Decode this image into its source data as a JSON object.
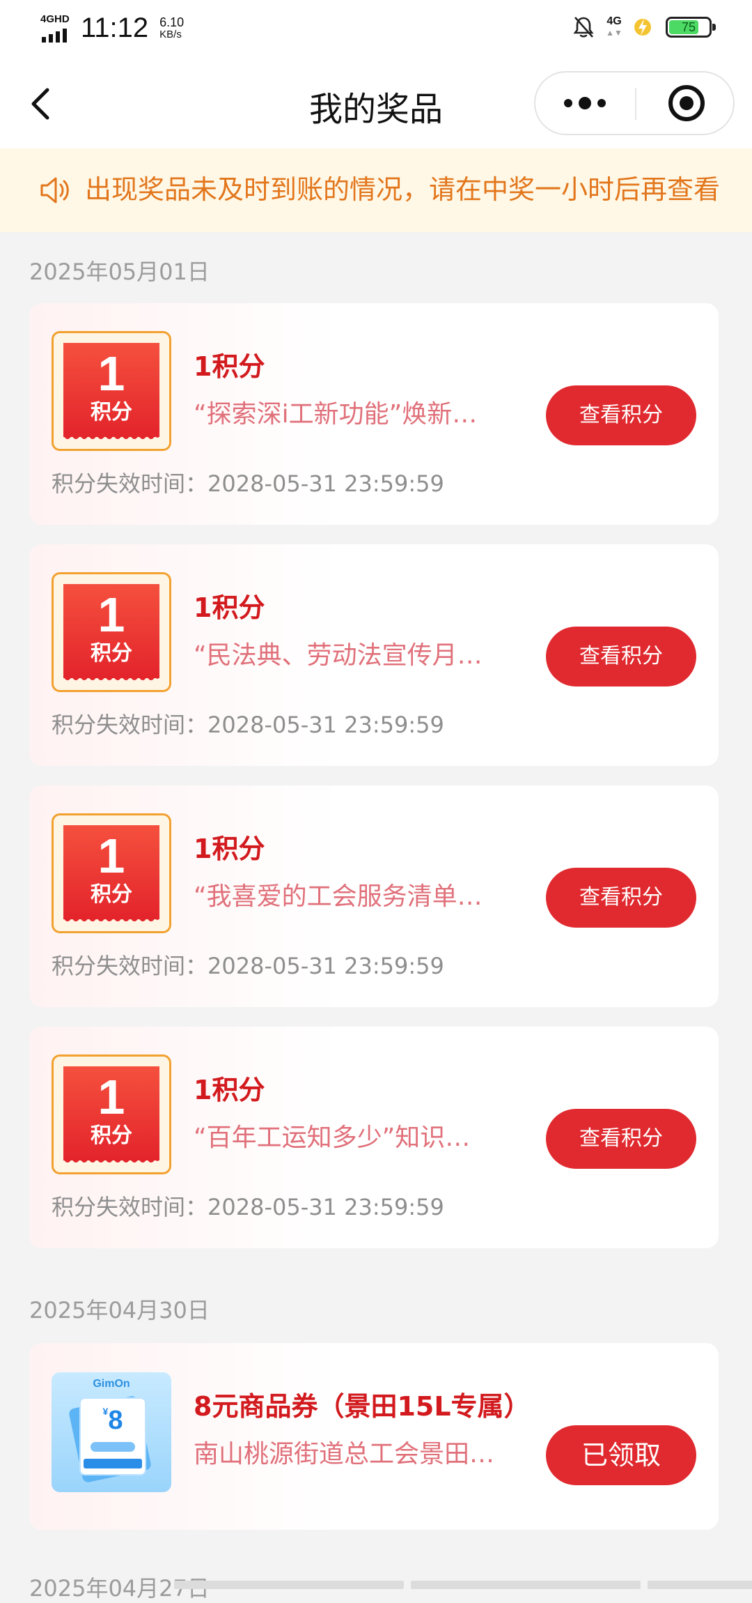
{
  "status_bar": {
    "network_left": "4GHD",
    "time": "11:12",
    "speed_value": "6.10",
    "speed_unit": "KB/s",
    "network_right": "4G",
    "battery_level": "75",
    "icons": [
      "mute-bell-icon",
      "charging-icon"
    ]
  },
  "nav": {
    "title": "我的奖品",
    "back_icon": "chevron-left-icon",
    "more_icon": "more-dots-icon",
    "close_icon": "target-close-icon"
  },
  "notice": {
    "icon": "speaker-icon",
    "text": "出现奖品未及时到账的情况，请在中奖一小时后再查看"
  },
  "sections": [
    {
      "date": "2025年05月01日",
      "items": [
        {
          "badge_num": "1",
          "badge_unit": "积分",
          "title": "1积分",
          "desc": "“探索深i工新功能”焕新…",
          "expiry": "积分失效时间：2028-05-31 23:59:59",
          "button": "查看积分"
        },
        {
          "badge_num": "1",
          "badge_unit": "积分",
          "title": "1积分",
          "desc": "“民法典、劳动法宣传月…",
          "expiry": "积分失效时间：2028-05-31 23:59:59",
          "button": "查看积分"
        },
        {
          "badge_num": "1",
          "badge_unit": "积分",
          "title": "1积分",
          "desc": "“我喜爱的工会服务清单…",
          "expiry": "积分失效时间：2028-05-31 23:59:59",
          "button": "查看积分"
        },
        {
          "badge_num": "1",
          "badge_unit": "积分",
          "title": "1积分",
          "desc": "“百年工运知多少”知识…",
          "expiry": "积分失效时间：2028-05-31 23:59:59",
          "button": "查看积分"
        }
      ]
    },
    {
      "date": "2025年04月30日",
      "items": [
        {
          "image_brand": "GimOn",
          "image_amount": "8",
          "image_currency": "¥",
          "title": "8元商品券（景田15L专属）",
          "desc": "南山桃源街道总工会景田…",
          "button": "已领取"
        }
      ]
    },
    {
      "date": "2025年04月27日"
    }
  ],
  "colors": {
    "accent_red": "#e02a2f",
    "title_red": "#d21a1e",
    "notice_orange": "#e2761c",
    "notice_bg": "#fff8e6",
    "badge_border": "#f2a12f"
  }
}
